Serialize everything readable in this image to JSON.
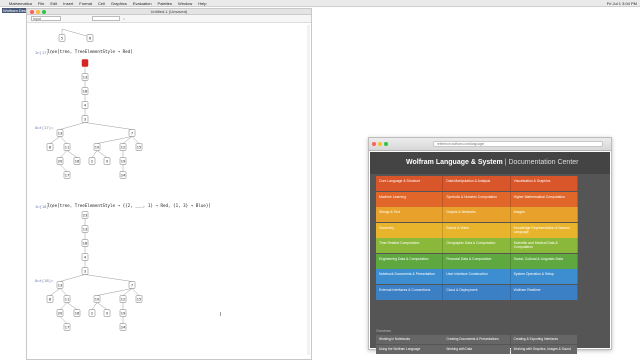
{
  "menubar": {
    "apple": "",
    "items": [
      "Mathematica",
      "File",
      "Edit",
      "Insert",
      "Format",
      "Cell",
      "Graphics",
      "Evaluation",
      "Palettes",
      "Window",
      "Help"
    ],
    "clock": "Fri Jul 1 3:04 PM"
  },
  "desktop": {
    "label": "Wolfram Desktop"
  },
  "notebook": {
    "title": "Untitled-1 (Unsaved)",
    "style_select": "Input",
    "cells": [
      {
        "label": "In[17]:=",
        "code": "Tree[tree, TreeElementStyle → Red]"
      },
      {
        "label": "Out[17]=",
        "code": ""
      },
      {
        "label": "In[18]:=",
        "code": "Tree[tree, TreeElementStyle → {{2, ___, 1} → Red, {1, 3} → Blue}]"
      },
      {
        "label": "Out[18]=",
        "code": ""
      }
    ],
    "tree_nodes": {
      "top_fragment": [
        "5",
        "6"
      ],
      "chain": [
        "23",
        "13",
        "18",
        "4",
        "3"
      ],
      "level2": [
        "13",
        "7"
      ],
      "level3": [
        "8",
        "11",
        "10",
        "12",
        "15"
      ],
      "level4": [
        "20",
        "16",
        "2",
        "9",
        "19"
      ],
      "level5": [
        "17",
        "24"
      ]
    },
    "highlight_color": "#d32525"
  },
  "doc": {
    "url": "reference.wolfram.com/language/",
    "title_main": "Wolfram Language & System",
    "title_sub": "Documentation Center",
    "categories": [
      [
        {
          "label": "Core Language & Structure",
          "color": "#d9552a"
        },
        {
          "label": "Data Manipulation & Analysis",
          "color": "#d9552a"
        },
        {
          "label": "Visualization & Graphics",
          "color": "#d9552a"
        }
      ],
      [
        {
          "label": "Machine Learning",
          "color": "#e0662a"
        },
        {
          "label": "Symbolic & Numeric Computation",
          "color": "#e0662a"
        },
        {
          "label": "Higher Mathematical Computation",
          "color": "#e0662a"
        }
      ],
      [
        {
          "label": "Strings & Text",
          "color": "#e8a22b"
        },
        {
          "label": "Graphs & Networks",
          "color": "#e8a22b"
        },
        {
          "label": "Images",
          "color": "#e8a22b"
        }
      ],
      [
        {
          "label": "Geometry",
          "color": "#e8b42b"
        },
        {
          "label": "Sound & Video",
          "color": "#e8b42b"
        },
        {
          "label": "Knowledge Representation & Natural Language",
          "color": "#e8b42b"
        }
      ],
      [
        {
          "label": "Time-Related Computation",
          "color": "#8ab83a"
        },
        {
          "label": "Geographic Data & Computation",
          "color": "#8ab83a"
        },
        {
          "label": "Scientific and Medical Data & Computation",
          "color": "#8ab83a"
        }
      ],
      [
        {
          "label": "Engineering Data & Computation",
          "color": "#5fa83f"
        },
        {
          "label": "Financial Data & Computation",
          "color": "#5fa83f"
        },
        {
          "label": "Social, Cultural & Linguistic Data",
          "color": "#5fa83f"
        }
      ],
      [
        {
          "label": "Notebook Documents & Presentation",
          "color": "#3d8ed0"
        },
        {
          "label": "User Interface Construction",
          "color": "#3d8ed0"
        },
        {
          "label": "System Operation & Setup",
          "color": "#3d8ed0"
        }
      ],
      [
        {
          "label": "External Interfaces & Connections",
          "color": "#3b7fc4"
        },
        {
          "label": "Cloud & Deployment",
          "color": "#3b7fc4"
        },
        {
          "label": "Wolfram Realtime",
          "color": "#3b7fc4"
        }
      ]
    ],
    "links_label": "Overviews",
    "links": [
      [
        "Working in Notebooks",
        "Creating Documents & Presentations",
        "Creating & Exporting Interfaces"
      ],
      [
        "Using the Wolfram Language",
        "Working with Data",
        "Working with Graphics, Images & Sound"
      ]
    ]
  }
}
